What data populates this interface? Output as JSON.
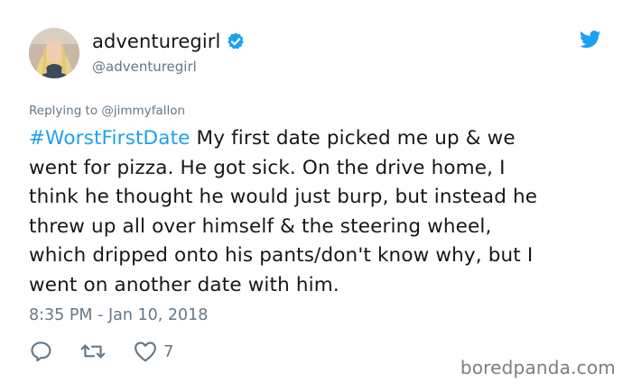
{
  "author": {
    "display_name": "adventuregirl",
    "handle": "@adventuregirl",
    "verified": true,
    "avatar_icon": "user-avatar"
  },
  "reply_to": {
    "prefix": "Replying to",
    "handle": "@jimmyfallon"
  },
  "tweet": {
    "hashtag": "#WorstFirstDate",
    "lines": [
      " My first date picked me up & we",
      "went for pizza. He got sick. On the drive home, I",
      "think he thought he would just burp, but instead he",
      "threw up all over himself & the steering wheel,",
      "which dripped onto his pants/don't know why, but I",
      "went on another date with him."
    ],
    "timestamp": "8:35 PM - Jan 10, 2018"
  },
  "actions": {
    "reply_icon": "reply-icon",
    "retweet_icon": "retweet-icon",
    "like_icon": "heart-icon",
    "like_count": "7"
  },
  "colors": {
    "link": "#1da1f2",
    "secondary_text": "#657786",
    "primary_text": "#14171a",
    "verified_badge": "#1da1f2",
    "twitter_bird": "#1da1f2"
  },
  "watermark": "boredpanda.com"
}
